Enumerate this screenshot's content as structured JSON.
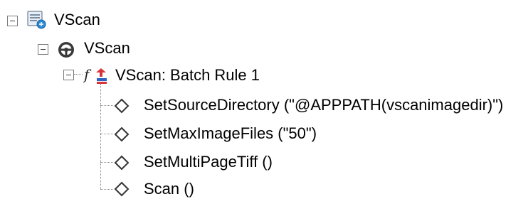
{
  "tree": {
    "root": {
      "label": "VScan",
      "icon": "server-computer-icon",
      "expanded": true,
      "children": [
        {
          "label": "VScan",
          "icon": "steering-wheel-icon",
          "expanded": true,
          "children": [
            {
              "label": "VScan: Batch Rule 1",
              "icon": "function-rule-icon",
              "expanded": true,
              "children": [
                {
                  "label": "SetSourceDirectory (\"@APPPATH(vscanimagedir)\")",
                  "icon": "diamond-icon"
                },
                {
                  "label": "SetMaxImageFiles (\"50\")",
                  "icon": "diamond-icon"
                },
                {
                  "label": "SetMultiPageTiff ()",
                  "icon": "diamond-icon"
                },
                {
                  "label": "Scan ()",
                  "icon": "diamond-icon"
                }
              ]
            }
          ]
        }
      ]
    }
  }
}
